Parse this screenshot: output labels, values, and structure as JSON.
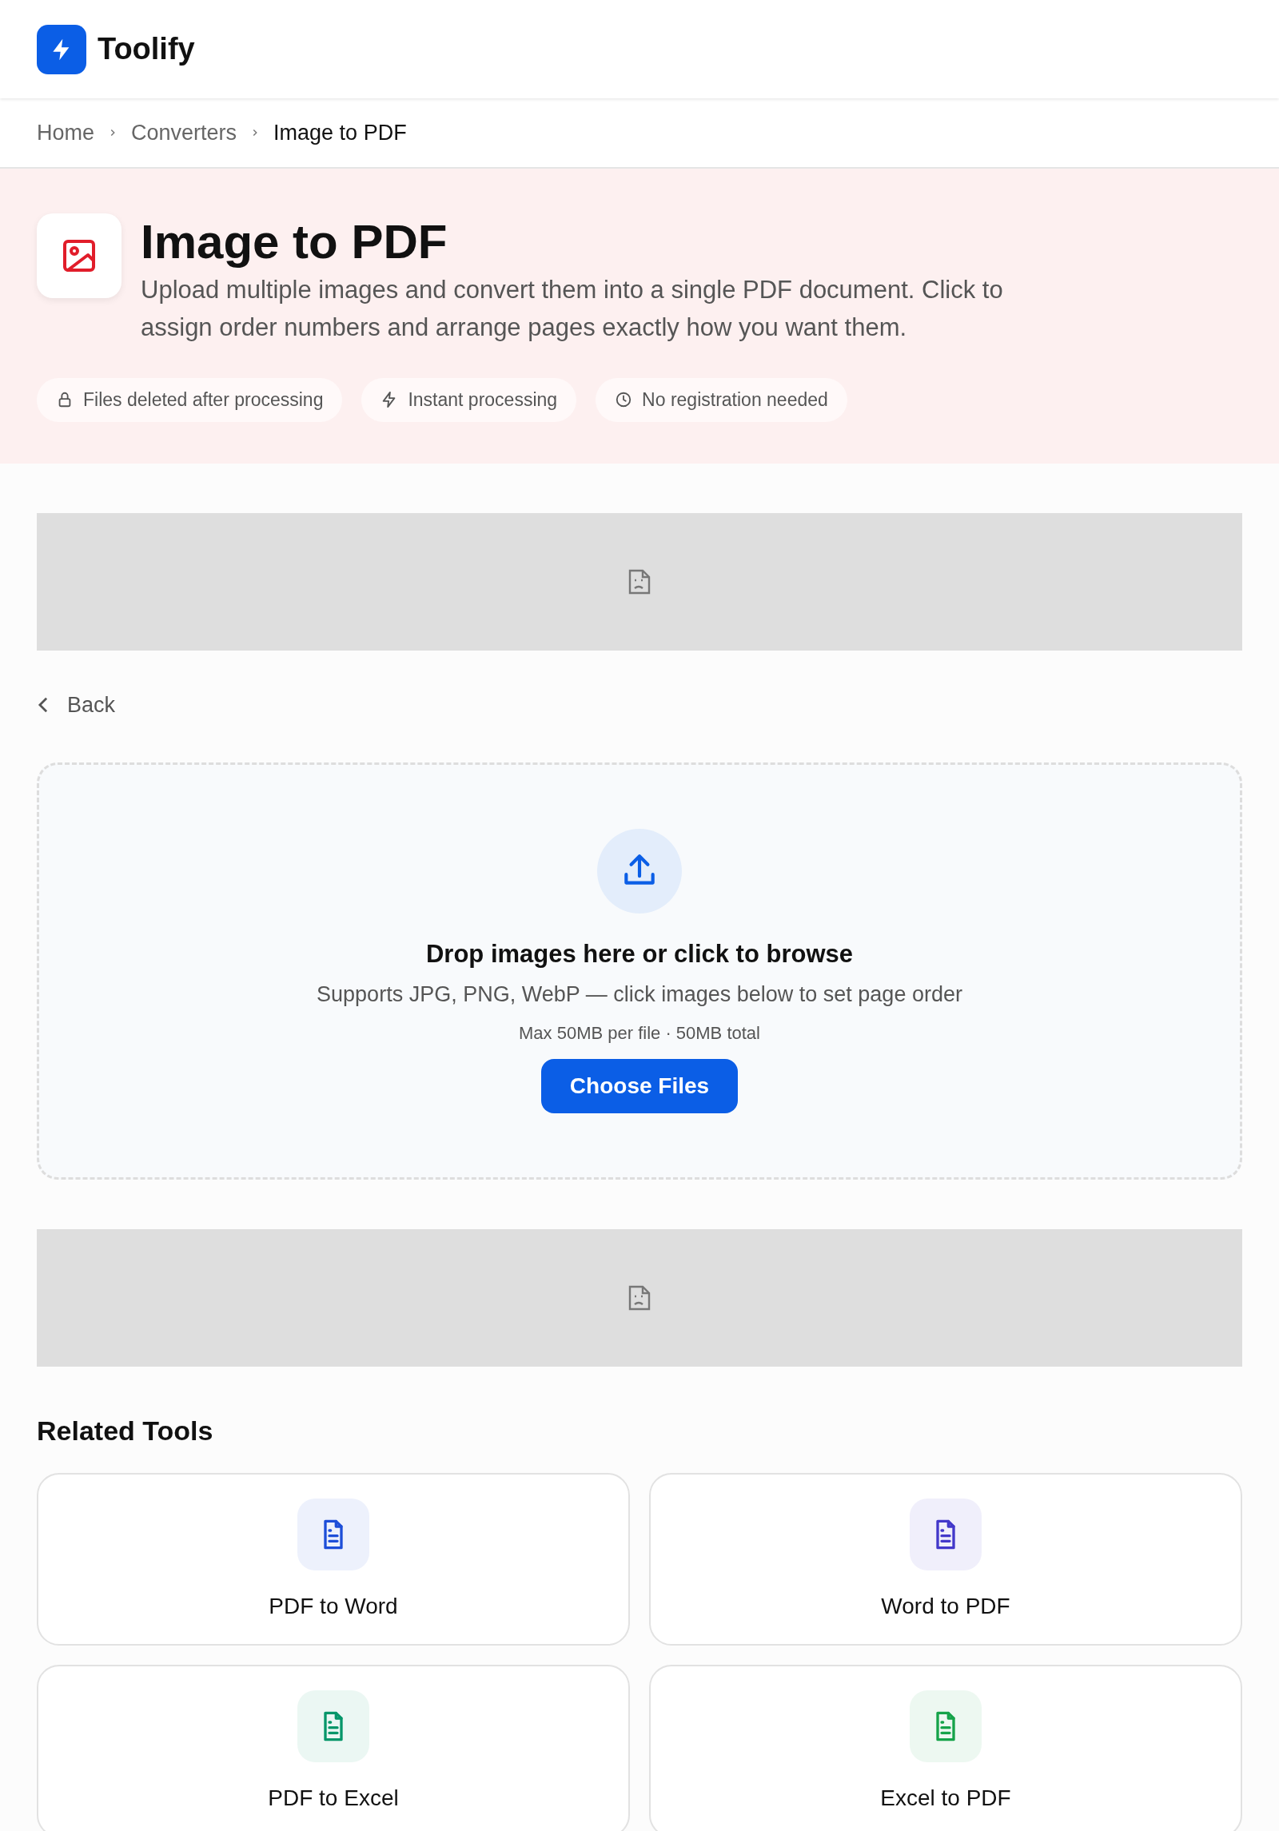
{
  "brand": {
    "name": "Toolify"
  },
  "breadcrumb": [
    {
      "label": "Home",
      "current": false
    },
    {
      "label": "Converters",
      "current": false
    },
    {
      "label": "Image to PDF",
      "current": true
    }
  ],
  "hero": {
    "title": "Image to PDF",
    "description": "Upload multiple images and convert them into a single PDF document. Click to assign order numbers and arrange pages exactly how you want them.",
    "features": [
      {
        "kind": "lock",
        "label": "Files deleted after processing"
      },
      {
        "kind": "bolt",
        "label": "Instant processing"
      },
      {
        "kind": "clock",
        "label": "No registration needed"
      }
    ]
  },
  "back_link": "Back",
  "dropzone": {
    "title": "Drop images here or click to browse",
    "subtitle": "Supports JPG, PNG, WebP — click images below to set page order",
    "limits": "Max 50MB per file · 50MB total",
    "button": "Choose Files"
  },
  "related": {
    "title": "Related Tools",
    "tools": [
      {
        "label": "PDF to Word",
        "color": "#1d4ed8"
      },
      {
        "label": "Word to PDF",
        "color": "#4338ca"
      },
      {
        "label": "PDF to Excel",
        "color": "#059669"
      },
      {
        "label": "Excel to PDF",
        "color": "#16a34a"
      }
    ]
  }
}
